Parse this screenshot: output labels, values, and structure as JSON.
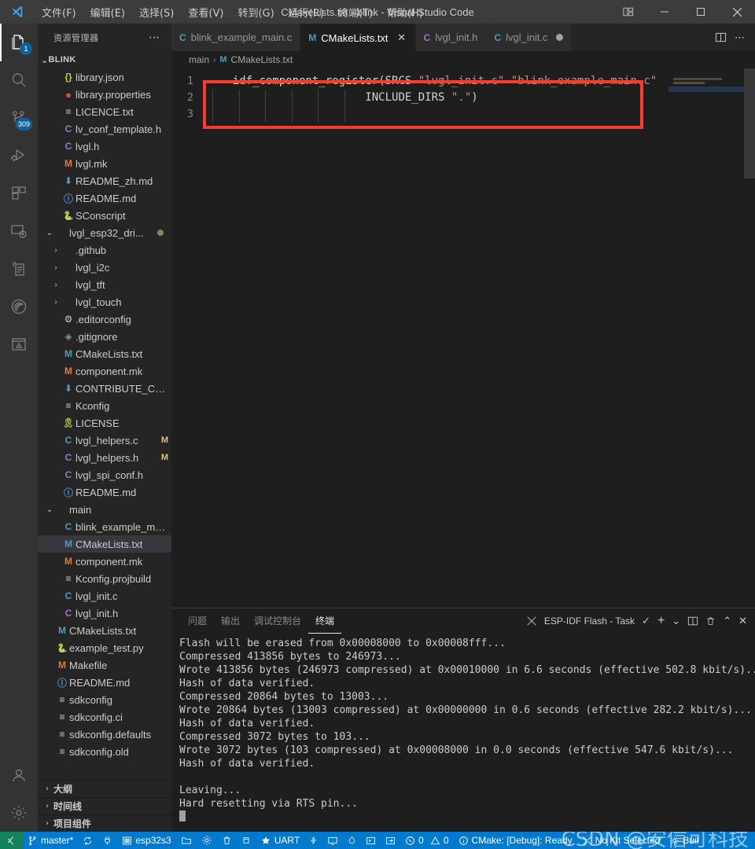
{
  "window": {
    "title": "CMakeLists.txt - blink - Visual Studio Code",
    "logo_icon": "vscode-logo-icon",
    "layout_icon": "customize-layout-icon",
    "minimize_icon": "minimize-icon",
    "maximize_icon": "maximize-icon",
    "close_icon": "close-icon"
  },
  "menu": [
    {
      "label": "文件(F)"
    },
    {
      "label": "编辑(E)"
    },
    {
      "label": "选择(S)"
    },
    {
      "label": "查看(V)"
    },
    {
      "label": "转到(G)"
    },
    {
      "label": "运行(R)"
    },
    {
      "label": "终端(T)"
    },
    {
      "label": "帮助(H)"
    }
  ],
  "activitybar": [
    {
      "name": "explorer",
      "icon": "files-icon",
      "badge": "1",
      "active": true
    },
    {
      "name": "search",
      "icon": "search-icon",
      "badge": "",
      "active": false
    },
    {
      "name": "source-control",
      "icon": "source-control-icon",
      "badge": "309",
      "active": false
    },
    {
      "name": "run-debug",
      "icon": "run-and-debug-icon",
      "badge": "",
      "active": false
    },
    {
      "name": "extensions",
      "icon": "extensions-icon",
      "badge": "",
      "active": false
    },
    {
      "name": "remote-explorer",
      "icon": "remote-explorer-icon",
      "badge": "",
      "active": false
    },
    {
      "name": "testing",
      "icon": "testing-icon",
      "badge": "",
      "active": false
    },
    {
      "name": "espressif-idf",
      "icon": "espressif-idf-icon",
      "badge": "",
      "active": false
    },
    {
      "name": "image-preview",
      "icon": "image-preview-icon",
      "badge": "",
      "active": false
    },
    {
      "name": "accounts",
      "icon": "account-icon",
      "badge": "",
      "active": false
    },
    {
      "name": "settings",
      "icon": "gear-icon",
      "badge": "",
      "active": false
    }
  ],
  "sidebar": {
    "title": "资源管理器",
    "more_icon": "more-actions-icon",
    "root": {
      "label": "BLINK",
      "expanded": true
    },
    "tree": [
      {
        "label": "library.json",
        "icon": "json-icon",
        "icon_class": "ic-json",
        "glyph": "{}",
        "indent": 2,
        "kind": "file"
      },
      {
        "label": "library.properties",
        "icon": "properties-icon",
        "icon_class": "ic-prop",
        "glyph": "●",
        "indent": 2,
        "kind": "file"
      },
      {
        "label": "LICENCE.txt",
        "icon": "text-file-icon",
        "icon_class": "ic-txt",
        "glyph": "≡",
        "indent": 2,
        "kind": "file"
      },
      {
        "label": "lv_conf_template.h",
        "icon": "c-header-icon",
        "icon_class": "ic-h",
        "glyph": "C",
        "indent": 2,
        "kind": "file"
      },
      {
        "label": "lvgl.h",
        "icon": "c-header-icon",
        "icon_class": "ic-h",
        "glyph": "C",
        "indent": 2,
        "kind": "file"
      },
      {
        "label": "lvgl.mk",
        "icon": "makefile-icon",
        "icon_class": "ic-mk",
        "glyph": "M",
        "indent": 2,
        "kind": "file"
      },
      {
        "label": "README_zh.md",
        "icon": "markdown-icon",
        "icon_class": "ic-md",
        "glyph": "⬇",
        "indent": 2,
        "kind": "file"
      },
      {
        "label": "README.md",
        "icon": "info-icon",
        "icon_class": "ic-info",
        "glyph": "ⓘ",
        "indent": 2,
        "kind": "file"
      },
      {
        "label": "SConscript",
        "icon": "python-icon",
        "icon_class": "ic-py",
        "glyph": "🐍",
        "indent": 2,
        "kind": "file"
      },
      {
        "label": "lvgl_esp32_dri...",
        "icon": "folder-icon",
        "icon_class": "",
        "glyph": "",
        "indent": 1,
        "kind": "folder-open",
        "dot": true
      },
      {
        "label": ".github",
        "icon": "folder-icon",
        "icon_class": "",
        "glyph": "",
        "indent": 2,
        "kind": "folder"
      },
      {
        "label": "lvgl_i2c",
        "icon": "folder-icon",
        "icon_class": "",
        "glyph": "",
        "indent": 2,
        "kind": "folder"
      },
      {
        "label": "lvgl_tft",
        "icon": "folder-icon",
        "icon_class": "",
        "glyph": "",
        "indent": 2,
        "kind": "folder"
      },
      {
        "label": "lvgl_touch",
        "icon": "folder-icon",
        "icon_class": "",
        "glyph": "",
        "indent": 2,
        "kind": "folder"
      },
      {
        "label": ".editorconfig",
        "icon": "gear-icon",
        "icon_class": "ic-gear",
        "glyph": "⚙",
        "indent": 2,
        "kind": "file"
      },
      {
        "label": ".gitignore",
        "icon": "git-icon",
        "icon_class": "ic-git",
        "glyph": "◈",
        "indent": 2,
        "kind": "file"
      },
      {
        "label": "CMakeLists.txt",
        "icon": "cmake-icon",
        "icon_class": "ic-m",
        "glyph": "M",
        "indent": 2,
        "kind": "file"
      },
      {
        "label": "component.mk",
        "icon": "makefile-icon",
        "icon_class": "ic-mk",
        "glyph": "M",
        "indent": 2,
        "kind": "file"
      },
      {
        "label": "CONTRIBUTE_CON...",
        "icon": "markdown-icon",
        "icon_class": "ic-md",
        "glyph": "⬇",
        "indent": 2,
        "kind": "file"
      },
      {
        "label": "Kconfig",
        "icon": "text-file-icon",
        "icon_class": "ic-txt",
        "glyph": "≡",
        "indent": 2,
        "kind": "file"
      },
      {
        "label": "LICENSE",
        "icon": "license-icon",
        "icon_class": "ic-lic",
        "glyph": "🎗",
        "indent": 2,
        "kind": "file"
      },
      {
        "label": "lvgl_helpers.c",
        "icon": "c-source-icon",
        "icon_class": "ic-c",
        "glyph": "C",
        "indent": 2,
        "kind": "file",
        "git": "M"
      },
      {
        "label": "lvgl_helpers.h",
        "icon": "c-header-icon",
        "icon_class": "ic-h",
        "glyph": "C",
        "indent": 2,
        "kind": "file",
        "git": "M"
      },
      {
        "label": "lvgl_spi_conf.h",
        "icon": "c-header-icon",
        "icon_class": "ic-h",
        "glyph": "C",
        "indent": 2,
        "kind": "file"
      },
      {
        "label": "README.md",
        "icon": "info-icon",
        "icon_class": "ic-info",
        "glyph": "ⓘ",
        "indent": 2,
        "kind": "file"
      },
      {
        "label": "main",
        "icon": "folder-icon",
        "icon_class": "",
        "glyph": "",
        "indent": 1,
        "kind": "folder-open"
      },
      {
        "label": "blink_example_main.c",
        "icon": "c-source-icon",
        "icon_class": "ic-c",
        "glyph": "C",
        "indent": 2,
        "kind": "file"
      },
      {
        "label": "CMakeLists.txt",
        "icon": "cmake-icon",
        "icon_class": "ic-m",
        "glyph": "M",
        "indent": 2,
        "kind": "file",
        "selected": true
      },
      {
        "label": "component.mk",
        "icon": "makefile-icon",
        "icon_class": "ic-mk",
        "glyph": "M",
        "indent": 2,
        "kind": "file"
      },
      {
        "label": "Kconfig.projbuild",
        "icon": "text-file-icon",
        "icon_class": "ic-txt",
        "glyph": "≡",
        "indent": 2,
        "kind": "file"
      },
      {
        "label": "lvgl_init.c",
        "icon": "c-source-icon",
        "icon_class": "ic-c",
        "glyph": "C",
        "indent": 2,
        "kind": "file"
      },
      {
        "label": "lvgl_init.h",
        "icon": "c-header-icon",
        "icon_class": "ic-h",
        "glyph": "C",
        "indent": 2,
        "kind": "file"
      },
      {
        "label": "CMakeLists.txt",
        "icon": "cmake-icon",
        "icon_class": "ic-m",
        "glyph": "M",
        "indent": 1,
        "kind": "file"
      },
      {
        "label": "example_test.py",
        "icon": "python-icon",
        "icon_class": "ic-py",
        "glyph": "🐍",
        "indent": 1,
        "kind": "file"
      },
      {
        "label": "Makefile",
        "icon": "makefile-icon",
        "icon_class": "ic-mk",
        "glyph": "M",
        "indent": 1,
        "kind": "file"
      },
      {
        "label": "README.md",
        "icon": "info-icon",
        "icon_class": "ic-info",
        "glyph": "ⓘ",
        "indent": 1,
        "kind": "file"
      },
      {
        "label": "sdkconfig",
        "icon": "text-file-icon",
        "icon_class": "ic-txt",
        "glyph": "≡",
        "indent": 1,
        "kind": "file"
      },
      {
        "label": "sdkconfig.ci",
        "icon": "text-file-icon",
        "icon_class": "ic-txt",
        "glyph": "≡",
        "indent": 1,
        "kind": "file"
      },
      {
        "label": "sdkconfig.defaults",
        "icon": "text-file-icon",
        "icon_class": "ic-txt",
        "glyph": "≡",
        "indent": 1,
        "kind": "file"
      },
      {
        "label": "sdkconfig.old",
        "icon": "text-file-icon",
        "icon_class": "ic-txt",
        "glyph": "≡",
        "indent": 1,
        "kind": "file"
      }
    ],
    "sections": [
      {
        "label": "大纲"
      },
      {
        "label": "时间线"
      },
      {
        "label": "项目组件"
      }
    ]
  },
  "tabs": [
    {
      "label": "blink_example_main.c",
      "glyph": "C",
      "icon_class": "ic-c",
      "active": false,
      "dirty": false,
      "closable": false
    },
    {
      "label": "CMakeLists.txt",
      "glyph": "M",
      "icon_class": "ic-m",
      "active": true,
      "dirty": false,
      "closable": true
    },
    {
      "label": "lvgl_init.h",
      "glyph": "C",
      "icon_class": "ic-h",
      "active": false,
      "dirty": false,
      "closable": false
    },
    {
      "label": "lvgl_init.c",
      "glyph": "C",
      "icon_class": "ic-c",
      "active": false,
      "dirty": true,
      "closable": false
    }
  ],
  "editor_actions": {
    "split_icon": "split-editor-icon",
    "more_icon": "more-actions-icon"
  },
  "breadcrumb": {
    "folder": "main",
    "separator": "›",
    "file_glyph": "M",
    "file": "CMakeLists.txt"
  },
  "code": {
    "line_numbers": [
      "1",
      "2",
      "3"
    ],
    "lines": [
      [
        {
          "t": "    ",
          "c": "tok-id"
        },
        {
          "t": "idf_component_register",
          "c": "tok-fn"
        },
        {
          "t": "(",
          "c": "tok-id"
        },
        {
          "t": "SRCS",
          "c": "tok-id"
        },
        {
          "t": " ",
          "c": "tok-id"
        },
        {
          "t": "\"lvgl_init.c\"",
          "c": "tok-str"
        },
        {
          "t": " ",
          "c": "tok-id"
        },
        {
          "t": "\"blink_example_main.c\"",
          "c": "tok-str"
        }
      ],
      [
        {
          "t": "                        ",
          "c": "tok-id"
        },
        {
          "t": "INCLUDE_DIRS",
          "c": "tok-id"
        },
        {
          "t": " ",
          "c": "tok-id"
        },
        {
          "t": "\".\"",
          "c": "tok-str"
        },
        {
          "t": ")",
          "c": "tok-id"
        }
      ],
      [
        {
          "t": "",
          "c": "tok-id"
        }
      ]
    ],
    "annotation_color": "#ff3b30"
  },
  "panel": {
    "tabs": [
      {
        "label": "问题",
        "active": false
      },
      {
        "label": "输出",
        "active": false
      },
      {
        "label": "调试控制台",
        "active": false
      },
      {
        "label": "终端",
        "active": true
      }
    ],
    "terminal_name": "ESP-IDF Flash - Task",
    "actions": [
      {
        "name": "task-check-icon",
        "glyph": "✓"
      },
      {
        "name": "new-terminal-icon",
        "glyph": "+"
      },
      {
        "name": "chevron-down-icon",
        "glyph": "⌄"
      },
      {
        "name": "split-terminal-icon",
        "glyph": "▯"
      },
      {
        "name": "kill-terminal-icon",
        "glyph": "🗑"
      },
      {
        "name": "maximize-panel-icon",
        "glyph": "⌃"
      },
      {
        "name": "close-panel-icon",
        "glyph": "✕"
      }
    ],
    "terminal_lines": [
      "Flash will be erased from 0x00008000 to 0x00008fff...",
      "Compressed 413856 bytes to 246973...",
      "Wrote 413856 bytes (246973 compressed) at 0x00010000 in 6.6 seconds (effective 502.8 kbit/s)...",
      "Hash of data verified.",
      "Compressed 20864 bytes to 13003...",
      "Wrote 20864 bytes (13003 compressed) at 0x00000000 in 0.6 seconds (effective 282.2 kbit/s)...",
      "Hash of data verified.",
      "Compressed 3072 bytes to 103...",
      "Wrote 3072 bytes (103 compressed) at 0x00008000 in 0.0 seconds (effective 547.6 kbit/s)...",
      "Hash of data verified.",
      "",
      "Leaving...",
      "Hard resetting via RTS pin..."
    ]
  },
  "statusbar": {
    "remote_icon": "remote-window-icon",
    "left": [
      {
        "name": "branch",
        "icon": "source-control-icon",
        "label": "master*"
      },
      {
        "name": "sync",
        "icon": "sync-icon",
        "label": ""
      },
      {
        "name": "serial-port",
        "icon": "plug-icon",
        "label": ""
      },
      {
        "name": "target-device",
        "icon": "chip-icon",
        "label": "esp32s3"
      },
      {
        "name": "open-folder",
        "icon": "folder-icon",
        "label": ""
      },
      {
        "name": "menuconfig",
        "icon": "gear-icon",
        "label": ""
      },
      {
        "name": "full-clean",
        "icon": "trash-icon",
        "label": ""
      },
      {
        "name": "build",
        "icon": "database-icon",
        "label": ""
      },
      {
        "name": "flash-method",
        "icon": "star-icon",
        "label": "UART"
      },
      {
        "name": "flash-device",
        "icon": "zap-icon",
        "label": ""
      },
      {
        "name": "monitor-device",
        "icon": "monitor-icon",
        "label": ""
      },
      {
        "name": "idf-monitor",
        "icon": "flame-icon",
        "label": ""
      },
      {
        "name": "open-terminal",
        "icon": "terminal-icon",
        "label": ""
      },
      {
        "name": "idf-doctor",
        "icon": "sign-in-icon",
        "label": ""
      }
    ],
    "problems": {
      "error_icon": "error-icon",
      "errors": "0",
      "warning_icon": "warning-icon",
      "warnings": "0"
    },
    "right": [
      {
        "name": "cmake-status",
        "icon": "info-icon",
        "label": "CMake: [Debug]: Ready"
      },
      {
        "name": "cmake-kit",
        "icon": "tools-icon",
        "label": "No Kit Selected"
      },
      {
        "name": "cmake-build",
        "icon": "cmake-icon",
        "label": "Buil"
      }
    ],
    "watermark": "CSDN @安信可科技",
    "accent_color": "#007acc",
    "remote_color": "#16825d"
  }
}
